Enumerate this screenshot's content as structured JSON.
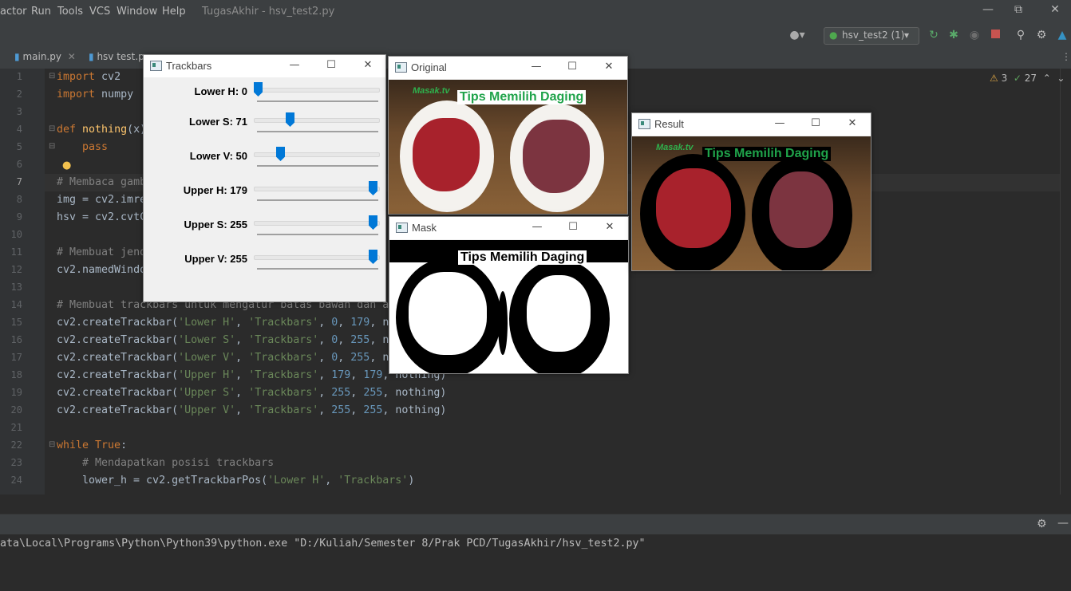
{
  "menu": {
    "items": [
      "actor",
      "Run",
      "Tools",
      "VCS",
      "Window",
      "Help"
    ],
    "title": "TugasAkhir - hsv_test2.py"
  },
  "toolbar": {
    "run_config": "hsv_test2 (1)"
  },
  "tabs": [
    {
      "label": "main.py"
    },
    {
      "label": "hsv test.p"
    }
  ],
  "editor": {
    "inspection": {
      "warnings": "3",
      "weak": "27"
    },
    "line_numbers": [
      "1",
      "2",
      "3",
      "4",
      "5",
      "6",
      "7",
      "8",
      "9",
      "10",
      "11",
      "12",
      "13",
      "14",
      "15",
      "16",
      "17",
      "18",
      "19",
      "20",
      "21",
      "22",
      "23",
      "24"
    ]
  },
  "code": {
    "l1a": "import",
    "l1b": " cv2",
    "l2a": "import",
    "l2b": " numpy ",
    "l4a": "def",
    "l4b": " nothing",
    "l4c": "(x)",
    "l5": "pass",
    "l7": "# Membaca gamb",
    "l8": "img = cv2.imre",
    "l9": "hsv = cv2.cvtC",
    "l11": "# Membuat jend",
    "l12": "cv2.namedWindo",
    "l14": "# Membuat trackbars untuk mengatur batas bawah dan a",
    "l15a": "cv2.createTrackbar(",
    "l15b": "'Lower H'",
    "l15c": ", ",
    "l15d": "'Trackbars'",
    "l15e": ", ",
    "l15f": "0",
    "l15g": ", ",
    "l15h": "179",
    "l15i": ", n",
    "l16a": "cv2.createTrackbar(",
    "l16b": "'Lower S'",
    "l16c": ", ",
    "l16d": "'Trackbars'",
    "l16e": ", ",
    "l16f": "0",
    "l16g": ", ",
    "l16h": "255",
    "l16i": ", n",
    "l17a": "cv2.createTrackbar(",
    "l17b": "'Lower V'",
    "l17c": ", ",
    "l17d": "'Trackbars'",
    "l17e": ", ",
    "l17f": "0",
    "l17g": ", ",
    "l17h": "255",
    "l17i": ", n",
    "l18a": "cv2.createTrackbar(",
    "l18b": "'Upper H'",
    "l18c": ", ",
    "l18d": "'Trackbars'",
    "l18e": ", ",
    "l18f": "179",
    "l18g": ", ",
    "l18h": "179",
    "l18i": ", nothing)",
    "l19a": "cv2.createTrackbar(",
    "l19b": "'Upper S'",
    "l19c": ", ",
    "l19d": "'Trackbars'",
    "l19e": ", ",
    "l19f": "255",
    "l19g": ", ",
    "l19h": "255",
    "l19i": ", nothing)",
    "l20a": "cv2.createTrackbar(",
    "l20b": "'Upper V'",
    "l20c": ", ",
    "l20d": "'Trackbars'",
    "l20e": ", ",
    "l20f": "255",
    "l20g": ", ",
    "l20h": "255",
    "l20i": ", nothing)",
    "l22a": "while",
    "l22b": " True",
    "l22c": ":",
    "l23": "# Mendapatkan posisi trackbars",
    "l24a": "lower_h = cv2.getTrackbarPos(",
    "l24b": "'Lower H'",
    "l24c": ", ",
    "l24d": "'Trackbars'",
    "l24e": ")"
  },
  "run": {
    "command": "ata\\Local\\Programs\\Python\\Python39\\python.exe \"D:/Kuliah/Semester 8/Prak PCD/TugasAkhir/hsv_test2.py\""
  },
  "windows": {
    "trackbars_title": "Trackbars",
    "original_title": "Original",
    "mask_title": "Mask",
    "result_title": "Result"
  },
  "trackbars": [
    {
      "label": "Lower H: 0",
      "value": 0,
      "max": 179
    },
    {
      "label": "Lower S: 71",
      "value": 71,
      "max": 255
    },
    {
      "label": "Lower V: 50",
      "value": 50,
      "max": 255
    },
    {
      "label": "Upper H: 179",
      "value": 179,
      "max": 179
    },
    {
      "label": "Upper S: 255",
      "value": 255,
      "max": 255
    },
    {
      "label": "Upper V: 255",
      "value": 255,
      "max": 255
    }
  ],
  "image": {
    "banner_text": "Tips Memilih Daging",
    "logo_text": "Masak.tv"
  },
  "colors": {
    "banner_green": "#1fa34a",
    "accent_blue": "#0078d7"
  }
}
